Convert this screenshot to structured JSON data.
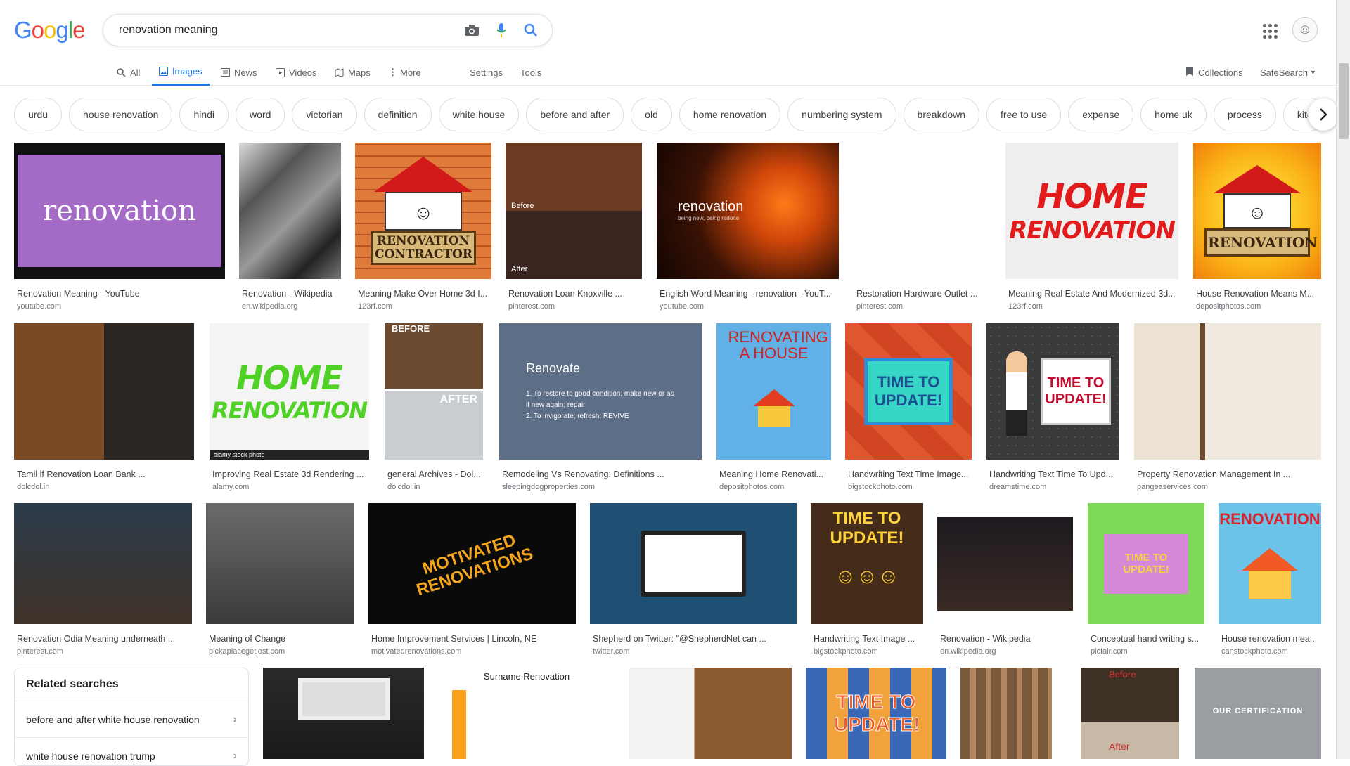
{
  "logo": {
    "text": "Google"
  },
  "search": {
    "query": "renovation meaning"
  },
  "icons": {
    "camera": "camera-icon",
    "mic": "mic-icon",
    "search": "search-icon",
    "apps": "apps-icon",
    "avatar": "avatar"
  },
  "tabs": [
    {
      "label": "All",
      "icon": "search-icon"
    },
    {
      "label": "Images",
      "icon": "image-icon",
      "active": true
    },
    {
      "label": "News",
      "icon": "news-icon"
    },
    {
      "label": "Videos",
      "icon": "video-icon"
    },
    {
      "label": "Maps",
      "icon": "map-icon"
    },
    {
      "label": "More",
      "icon": "more-icon"
    },
    {
      "label": "Settings"
    },
    {
      "label": "Tools"
    }
  ],
  "collections": "Collections",
  "safesearch": "SafeSearch",
  "chips": [
    "urdu",
    "house renovation",
    "hindi",
    "word",
    "victorian",
    "definition",
    "white house",
    "before and after",
    "old",
    "home renovation",
    "numbering system",
    "breakdown",
    "free to use",
    "expense",
    "home uk",
    "process",
    "kitc"
  ],
  "results": {
    "row1": [
      {
        "caption": "Renovation Meaning - YouTube",
        "domain": "youtube.com",
        "img_text": "renovation"
      },
      {
        "caption": "Renovation - Wikipedia",
        "domain": "en.wikipedia.org"
      },
      {
        "caption": "Meaning Make Over Home 3d I...",
        "domain": "123rf.com",
        "img_text": "RENOVATION CONTRACTOR"
      },
      {
        "caption": "Renovation Loan Knoxville ...",
        "domain": "pinterest.com",
        "img_text_1": "Before",
        "img_text_2": "After"
      },
      {
        "caption": "English Word Meaning - renovation - YouT...",
        "domain": "youtube.com",
        "img_text": "renovation",
        "img_sub": "being new, being redone"
      },
      {
        "caption": "Restoration Hardware Outlet ...",
        "domain": "pinterest.com"
      },
      {
        "caption": "Meaning Real Estate And Modernized 3d...",
        "domain": "123rf.com",
        "img_text_1": "HOME",
        "img_text_2": "RENOVATION"
      },
      {
        "caption": "House Renovation Means M...",
        "domain": "depositphotos.com",
        "img_text": "RENOVATION"
      }
    ],
    "row2": [
      {
        "caption": "Tamil if Renovation Loan Bank ...",
        "domain": "dolcdol.in"
      },
      {
        "caption": "Improving Real Estate 3d Rendering ...",
        "domain": "alamy.com",
        "img_text_1": "HOME",
        "img_text_2": "RENOVATION",
        "img_sub": "alamy stock photo"
      },
      {
        "caption": "general Archives - Dol...",
        "domain": "dolcdol.in",
        "img_text_1": "BEFORE",
        "img_text_2": "AFTER"
      },
      {
        "caption": "Remodeling Vs Renovating: Definitions ...",
        "domain": "sleepingdogproperties.com",
        "img_title": "Renovate",
        "img_line1": "1. To restore to good condition; make new or as if new again; repair",
        "img_line2": "2. To invigorate; refresh: REVIVE"
      },
      {
        "caption": "Meaning Home Renovati...",
        "domain": "depositphotos.com",
        "img_text": "RENOVATING A HOUSE"
      },
      {
        "caption": "Handwriting Text Time Image...",
        "domain": "bigstockphoto.com",
        "img_text": "TIME TO UPDATE!"
      },
      {
        "caption": "Handwriting Text Time To Upd...",
        "domain": "dreamstime.com",
        "img_text": "TIME TO UPDATE!"
      },
      {
        "caption": "Property Renovation Management In ...",
        "domain": "pangeaservices.com"
      }
    ],
    "row3": [
      {
        "caption": "Renovation Odia Meaning underneath ...",
        "domain": "pinterest.com"
      },
      {
        "caption": "Meaning of Change",
        "domain": "pickaplacegetlost.com"
      },
      {
        "caption": "Home Improvement Services | Lincoln, NE",
        "domain": "motivatedrenovations.com",
        "img_text": "MOTIVATED RENOVATIONS"
      },
      {
        "caption": "Shepherd on Twitter: \"@ShepherdNet can ...",
        "domain": "twitter.com"
      },
      {
        "caption": "Handwriting Text Image ...",
        "domain": "bigstockphoto.com",
        "img_text": "TIME TO UPDATE!"
      },
      {
        "caption": "Renovation - Wikipedia",
        "domain": "en.wikipedia.org"
      },
      {
        "caption": "Conceptual hand writing s...",
        "domain": "picfair.com",
        "img_text": "TIME TO UPDATE!"
      },
      {
        "caption": "House renovation mea...",
        "domain": "canstockphoto.com",
        "img_text": "RENOVATION"
      }
    ],
    "row4": [
      {
        "img_text": ""
      },
      {
        "img_text": "Surname Renovation"
      },
      {
        "img_text": ""
      },
      {
        "img_text": "TIME TO UPDATE!"
      },
      {
        "img_text": ""
      },
      {
        "img_text_1": "Before",
        "img_text_2": "After"
      },
      {
        "img_text": "OUR CERTIFICATION"
      }
    ]
  },
  "related": {
    "title": "Related searches",
    "items": [
      "before and after white house renovation",
      "white house renovation trump"
    ]
  }
}
